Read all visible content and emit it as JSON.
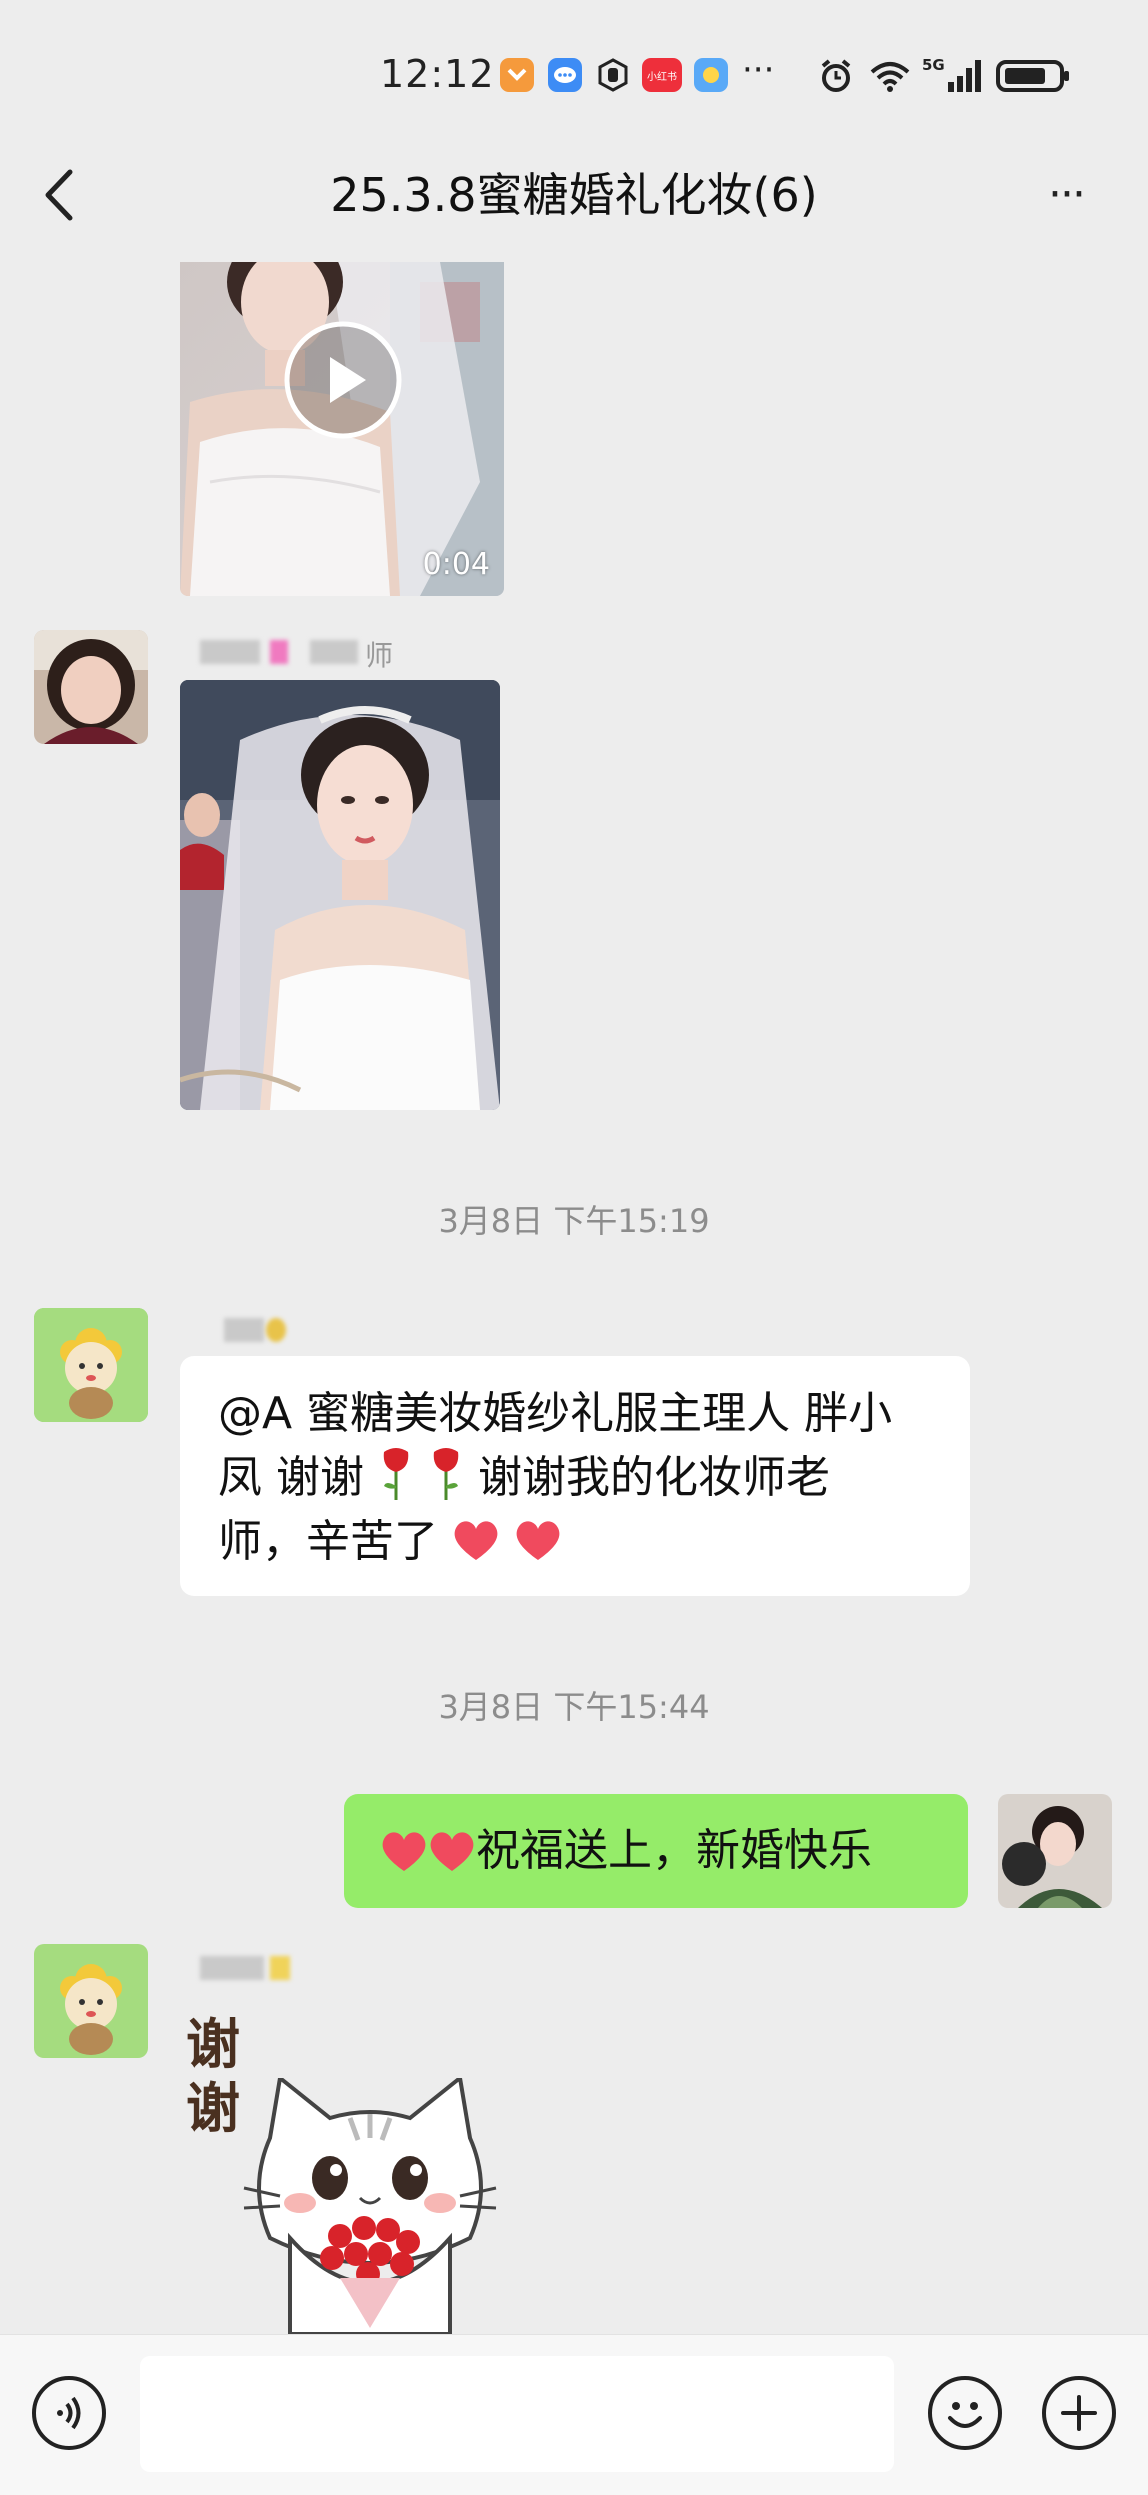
{
  "status_bar": {
    "time": "12:12",
    "network_label": "5G",
    "icons": [
      "app-icon-orange",
      "app-icon-blue-chat",
      "gesture-icon",
      "app-icon-red",
      "app-icon-weather",
      "more-dots-icon",
      "alarm-icon",
      "wifi-icon",
      "signal-icon",
      "battery-icon"
    ],
    "app_red_label": "小红书"
  },
  "nav": {
    "title": "25.3.8蜜糖婚礼化妆(6)",
    "back_icon": "chevron-left-icon",
    "more_icon": "more-dots-icon",
    "more_glyph": "···"
  },
  "messages": {
    "video": {
      "duration": "0:04"
    },
    "image_sender_suffix": "师",
    "timestamp_1": "3月8日 下午15:19",
    "text_msg": {
      "line1": "@A 蜜糖美妆婚纱礼服主理人 胖小",
      "line2_a": "凤  谢谢",
      "line2_b": "谢谢我的化妆师老",
      "line3_a": "师，辛苦了"
    },
    "timestamp_2": "3月8日 下午15:44",
    "my_msg": {
      "text": "祝福送上，新婚快乐"
    },
    "sticker": {
      "text_1": "谢",
      "text_2": "谢"
    }
  },
  "input_bar": {
    "voice_icon": "voice-icon",
    "emoji_icon": "emoji-icon",
    "plus_icon": "plus-icon",
    "input_value": ""
  },
  "colors": {
    "background": "#ededed",
    "my_bubble": "#95ec69",
    "other_bubble": "#ffffff",
    "timestamp": "#8c8c8c"
  }
}
